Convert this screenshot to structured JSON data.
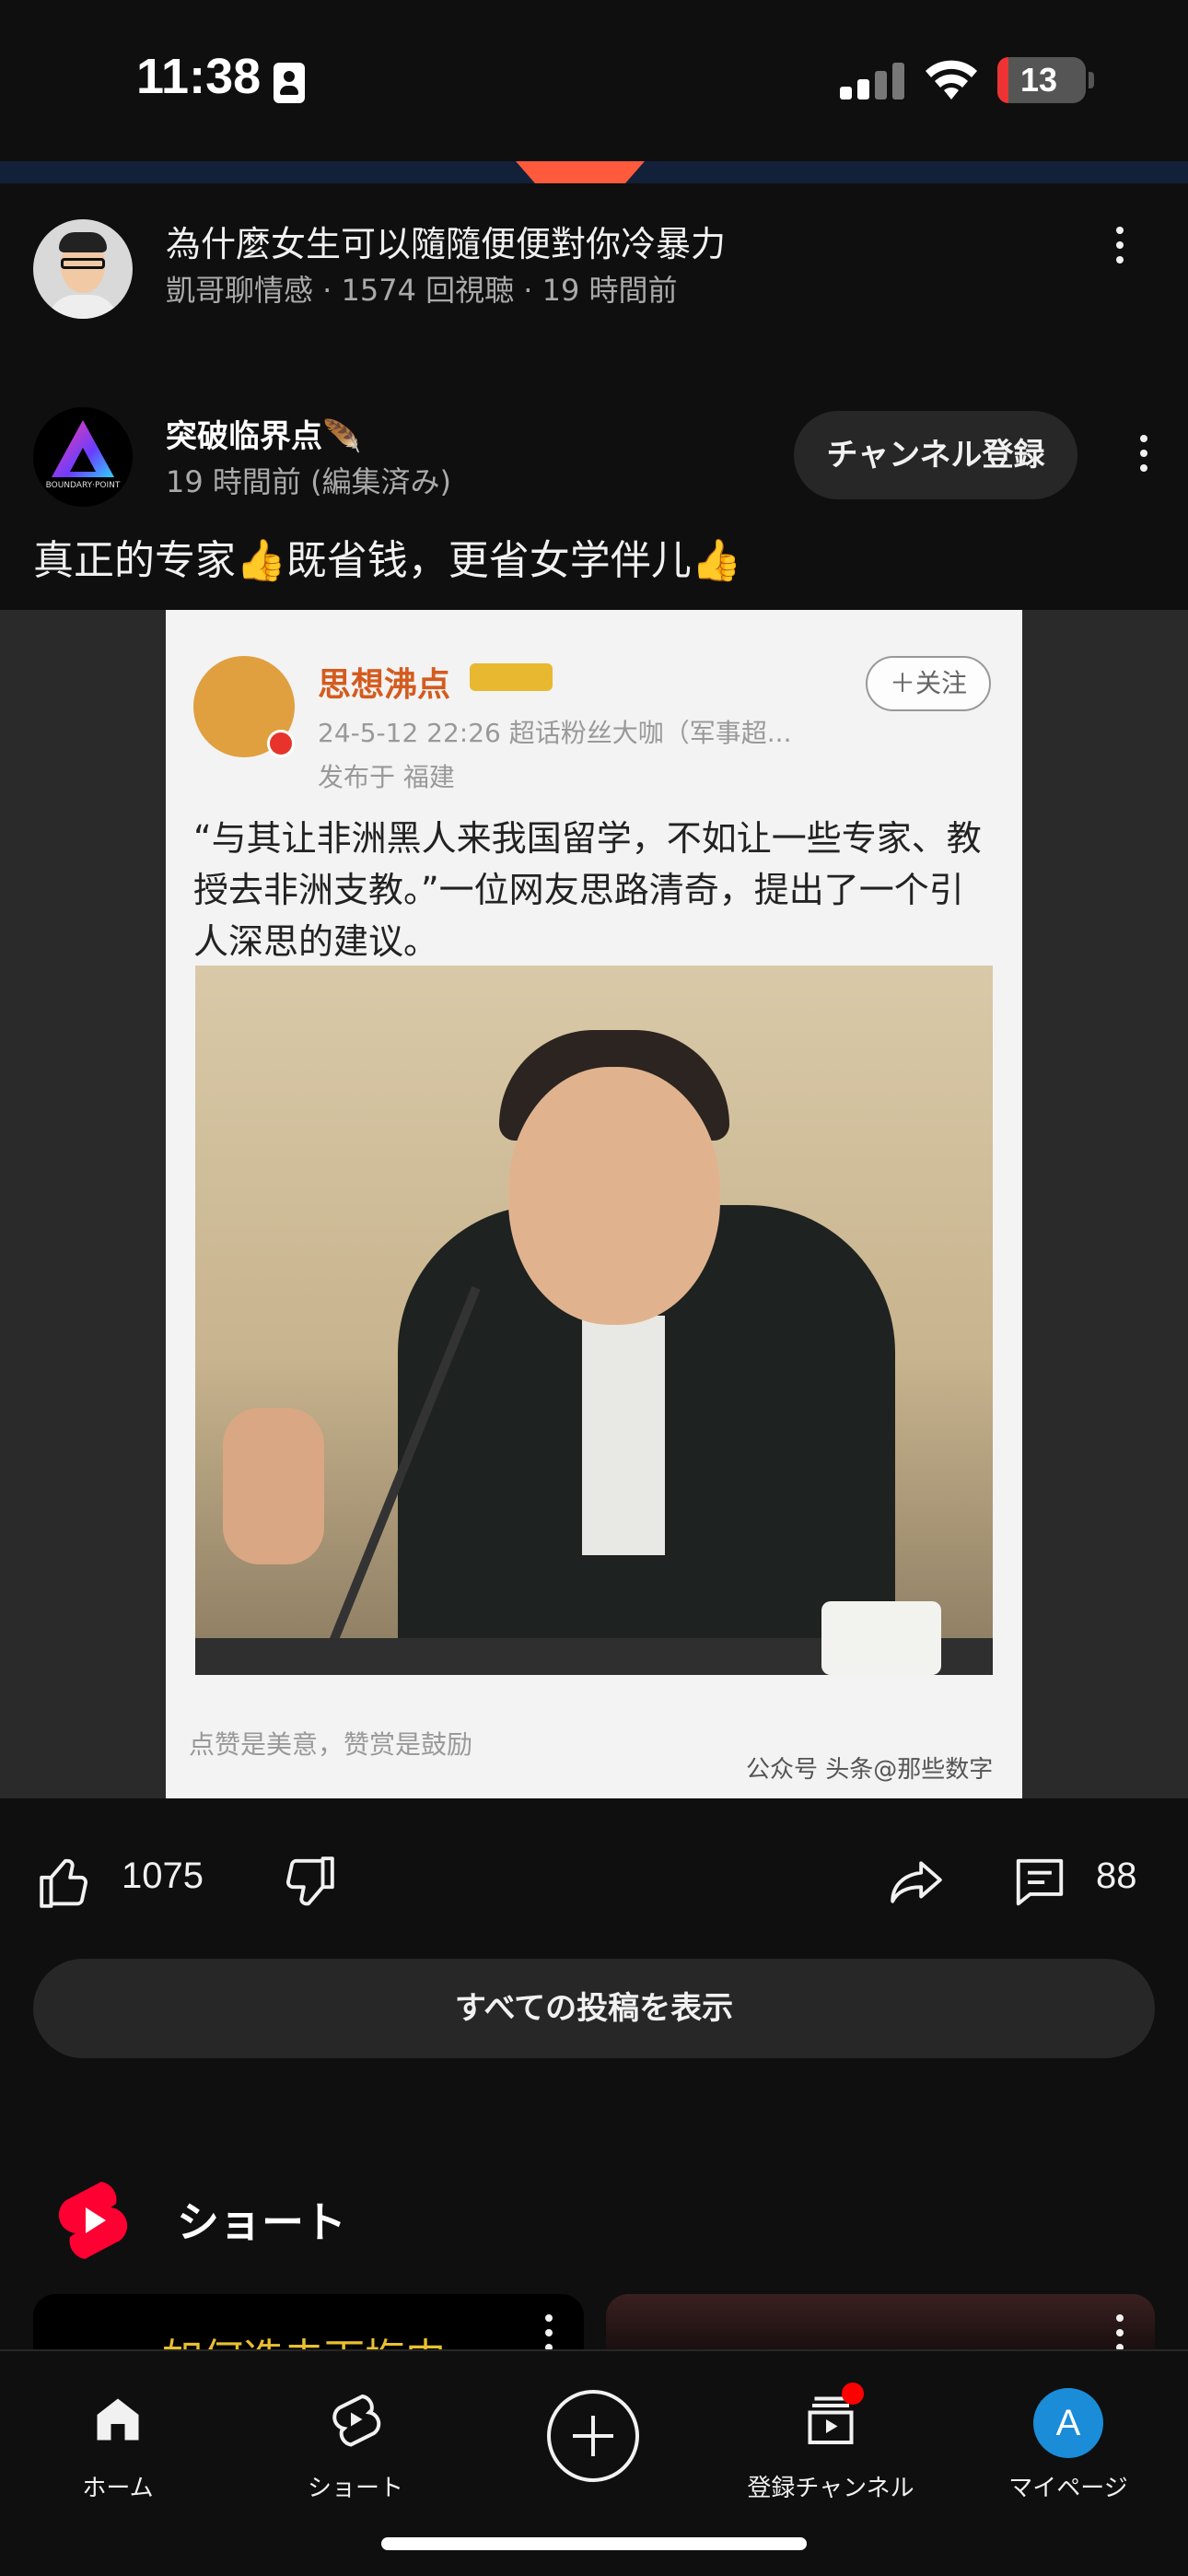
{
  "status_bar": {
    "time": "11:38",
    "battery": "13"
  },
  "video": {
    "title": "為什麼女生可以隨隨便便對你冷暴力",
    "meta": "凱哥聊情感 · 1574 回視聴 · 19 時間前"
  },
  "post": {
    "channel_name": "突破临界点🪶",
    "channel_avatar_text": "BOUNDARY·POINT",
    "time": "19 時間前 (編集済み)",
    "subscribe_label": "チャンネル登録",
    "text": "真正的专家👍既省钱，更省女学伴儿👍"
  },
  "image_card": {
    "user": "思想沸点",
    "meta": "24-5-12 22:26  超话粉丝大咖（军事超...",
    "location": "发布于 福建",
    "follow": "＋关注",
    "body": "“与其让非洲黑人来我国留学，不如让一些专家、教授去非洲支教。”一位网友思路清奇，提出了一个引人深思的建议。",
    "footer": "点赞是美意，赞赏是鼓励",
    "watermark": "公众号  头条@那些数字"
  },
  "actions": {
    "like_count": "1075",
    "comment_count": "88"
  },
  "view_all_label": "すべての投稿を表示",
  "shorts": {
    "title": "ショート",
    "card1_peek": "如何选去下梅内"
  },
  "nav": {
    "home": "ホーム",
    "shorts": "ショート",
    "subscriptions": "登録チャンネル",
    "me": "マイページ",
    "me_initial": "A"
  }
}
